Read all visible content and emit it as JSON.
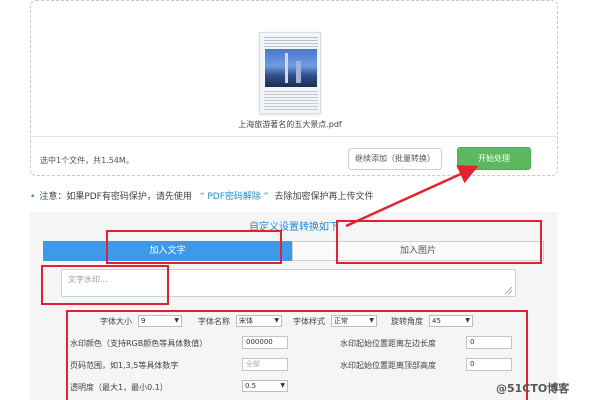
{
  "upload": {
    "file_name": "上海旅游著名的五大景点.pdf",
    "selected_info": "选中1个文件，共1.54M。",
    "continue_add_label": "继续添加（批量转换）",
    "start_label": "开始处理"
  },
  "notice": {
    "bullet": "•",
    "prefix": "注意：如果PDF有密码保护，请先使用",
    "link": "“ PDF密码解除 ”",
    "suffix": "去除加密保护再上传文件"
  },
  "settings": {
    "title": "自定义设置转换如下",
    "tabs": [
      "加入文字",
      "加入图片"
    ],
    "watermark_placeholder": "文字水印...",
    "font_size_label": "字体大小",
    "font_size_value": "9",
    "font_name_label": "字体名称",
    "font_name_value": "宋体",
    "font_style_label": "字体样式",
    "font_style_value": "正常",
    "rotation_label": "旋转角度",
    "rotation_value": "45",
    "color_label": "水印颜色（支持RGB颜色等具体数值）",
    "color_value": "000000",
    "left_offset_label": "水印起始位置距离左边长度",
    "left_offset_value": "0",
    "page_range_label": "页码范围，如1,3,5等具体数字",
    "page_range_placeholder": "全部",
    "top_offset_label": "水印起始位置距离顶部高度",
    "top_offset_value": "0",
    "opacity_label": "透明度（最大1，最小0.1）",
    "opacity_value": "0.5"
  },
  "brand_watermark": "@51CTO博客",
  "colors": {
    "accent": "#1e8cd8",
    "tab_active": "#3c9ae8",
    "start_button": "#5cb85c",
    "annotation_red": "#e0242f"
  }
}
